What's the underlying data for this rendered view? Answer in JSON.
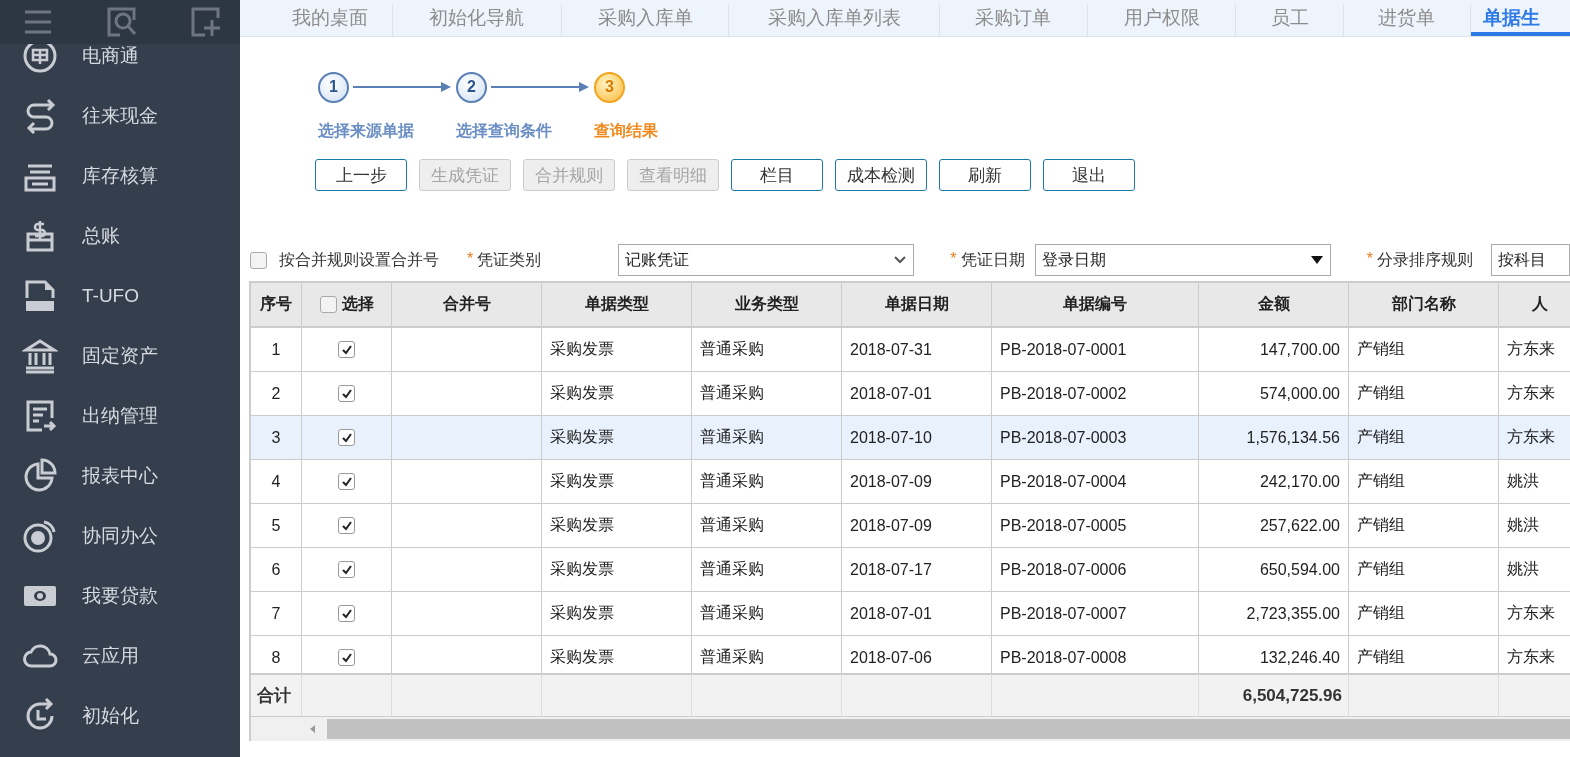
{
  "sidebar": {
    "items": [
      {
        "label": "电商通"
      },
      {
        "label": "往来现金"
      },
      {
        "label": "库存核算"
      },
      {
        "label": "总账"
      },
      {
        "label": "T-UFO"
      },
      {
        "label": "固定资产"
      },
      {
        "label": "出纳管理"
      },
      {
        "label": "报表中心"
      },
      {
        "label": "协同办公"
      },
      {
        "label": "我要贷款"
      },
      {
        "label": "云应用"
      },
      {
        "label": "初始化"
      }
    ]
  },
  "tabs": [
    {
      "label": "我的桌面",
      "selected": false
    },
    {
      "label": "初始化导航",
      "selected": false
    },
    {
      "label": "采购入库单",
      "selected": false
    },
    {
      "label": "采购入库单列表",
      "selected": false
    },
    {
      "label": "采购订单",
      "selected": false
    },
    {
      "label": "用户权限",
      "selected": false
    },
    {
      "label": "员工",
      "selected": false
    },
    {
      "label": "进货单",
      "selected": false
    },
    {
      "label": "单据生",
      "selected": true
    }
  ],
  "steps": [
    {
      "number": "1",
      "label": "选择来源单据",
      "selected": false
    },
    {
      "number": "2",
      "label": "选择查询条件",
      "selected": false
    },
    {
      "number": "3",
      "label": "查询结果",
      "selected": true
    }
  ],
  "buttons": [
    {
      "label": "上一步",
      "disabled": false
    },
    {
      "label": "生成凭证",
      "disabled": true
    },
    {
      "label": "合并规则",
      "disabled": true
    },
    {
      "label": "查看明细",
      "disabled": true
    },
    {
      "label": "栏目",
      "disabled": false
    },
    {
      "label": "成本检测",
      "disabled": false
    },
    {
      "label": "刷新",
      "disabled": false
    },
    {
      "label": "退出",
      "disabled": false
    }
  ],
  "filters": {
    "merge_checkbox": {
      "label": "按合并规则设置合并号",
      "checked": false
    },
    "voucher_type": {
      "required_mark": "*",
      "label": "凭证类别",
      "value": "记账凭证"
    },
    "voucher_date": {
      "required_mark": "*",
      "label": "凭证日期",
      "value": "登录日期"
    },
    "entry_sort": {
      "required_mark": "*",
      "label": "分录排序规则",
      "value": "按科目"
    }
  },
  "table": {
    "columns": [
      "序号",
      "选择",
      "合并号",
      "单据类型",
      "业务类型",
      "单据日期",
      "单据编号",
      "金额",
      "部门名称",
      "人"
    ],
    "select_all": false,
    "rows": [
      {
        "cells": [
          "1",
          "",
          "",
          "采购发票",
          "普通采购",
          "2018-07-31",
          "PB-2018-07-0001",
          "147,700.00",
          "产销组",
          "方东来"
        ],
        "checked": true,
        "selected": false
      },
      {
        "cells": [
          "2",
          "",
          "",
          "采购发票",
          "普通采购",
          "2018-07-01",
          "PB-2018-07-0002",
          "574,000.00",
          "产销组",
          "方东来"
        ],
        "checked": true,
        "selected": false
      },
      {
        "cells": [
          "3",
          "",
          "",
          "采购发票",
          "普通采购",
          "2018-07-10",
          "PB-2018-07-0003",
          "1,576,134.56",
          "产销组",
          "方东来"
        ],
        "checked": true,
        "selected": true
      },
      {
        "cells": [
          "4",
          "",
          "",
          "采购发票",
          "普通采购",
          "2018-07-09",
          "PB-2018-07-0004",
          "242,170.00",
          "产销组",
          "姚洪"
        ],
        "checked": true,
        "selected": false
      },
      {
        "cells": [
          "5",
          "",
          "",
          "采购发票",
          "普通采购",
          "2018-07-09",
          "PB-2018-07-0005",
          "257,622.00",
          "产销组",
          "姚洪"
        ],
        "checked": true,
        "selected": false
      },
      {
        "cells": [
          "6",
          "",
          "",
          "采购发票",
          "普通采购",
          "2018-07-17",
          "PB-2018-07-0006",
          "650,594.00",
          "产销组",
          "姚洪"
        ],
        "checked": true,
        "selected": false
      },
      {
        "cells": [
          "7",
          "",
          "",
          "采购发票",
          "普通采购",
          "2018-07-01",
          "PB-2018-07-0007",
          "2,723,355.00",
          "产销组",
          "方东来"
        ],
        "checked": true,
        "selected": false
      },
      {
        "cells": [
          "8",
          "",
          "",
          "采购发票",
          "普通采购",
          "2018-07-06",
          "PB-2018-07-0008",
          "132,246.40",
          "产销组",
          "方东来"
        ],
        "checked": true,
        "selected": false
      }
    ],
    "total_label": "合计",
    "total_amount": "6,504,725.96"
  }
}
